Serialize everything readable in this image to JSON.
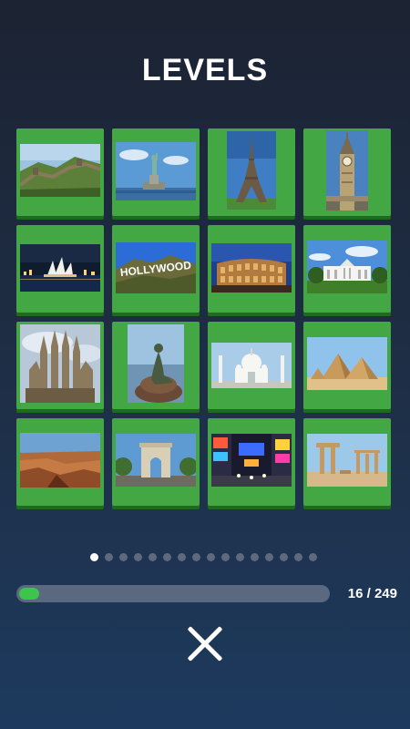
{
  "header": {
    "title": "LEVELS"
  },
  "levels": [
    {
      "name": "Great Wall of China"
    },
    {
      "name": "Statue of Liberty"
    },
    {
      "name": "Eiffel Tower"
    },
    {
      "name": "Big Ben"
    },
    {
      "name": "Sydney Opera House"
    },
    {
      "name": "Hollywood Sign",
      "sign_text": "HOLLYWOOD"
    },
    {
      "name": "Colosseum"
    },
    {
      "name": "White House"
    },
    {
      "name": "Sagrada Familia"
    },
    {
      "name": "Little Mermaid"
    },
    {
      "name": "Taj Mahal"
    },
    {
      "name": "Pyramids of Giza"
    },
    {
      "name": "Grand Canyon"
    },
    {
      "name": "Arc de Triomphe"
    },
    {
      "name": "Times Square"
    },
    {
      "name": "Palmyra Ruins"
    }
  ],
  "pagination": {
    "total_pages": 16,
    "current_page": 1
  },
  "progress": {
    "completed": 16,
    "total": 249,
    "label": "16 / 249"
  },
  "colors": {
    "tile": "#43a843",
    "progress": "#3fc34f",
    "accent_dot": "#ffffff"
  },
  "icons": {
    "close": "close-icon"
  }
}
